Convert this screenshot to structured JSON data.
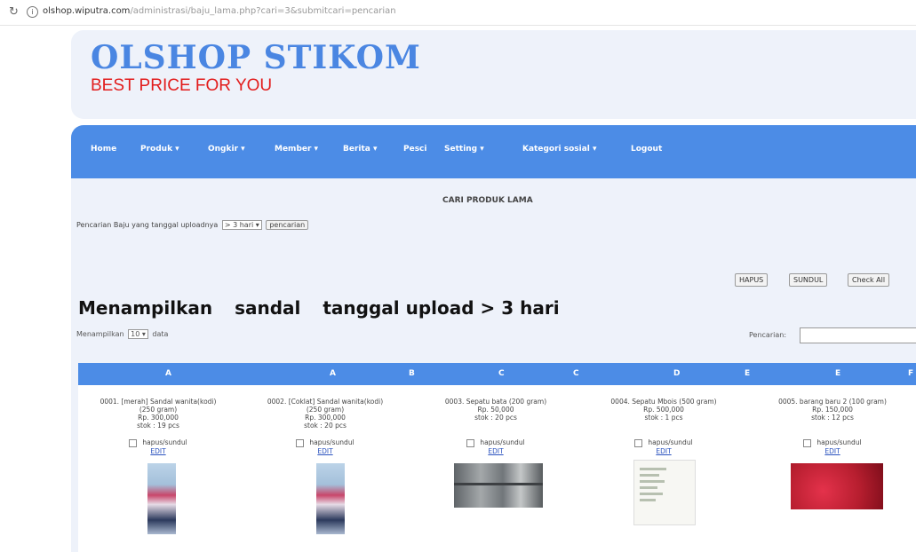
{
  "browser": {
    "domain": "olshop.wiputra.com",
    "path": "/administrasi/baju_lama.php?cari=3&submitcari=pencarian"
  },
  "site": {
    "title": "OLSHOP STIKOM",
    "tagline": "BEST PRICE FOR YOU"
  },
  "nav": [
    {
      "label": "Home"
    },
    {
      "label": "Produk ▾"
    },
    {
      "label": "Ongkir ▾"
    },
    {
      "label": "Member ▾"
    },
    {
      "label": "Berita ▾"
    },
    {
      "label": "Pesci"
    },
    {
      "label": "Setting ▾"
    },
    {
      "label": "Kategori sosial ▾"
    },
    {
      "label": "Logout"
    }
  ],
  "search_panel": {
    "title": "CARI PRODUK LAMA",
    "filter_label": "Pencarian Baju yang tanggal uploadnya",
    "filter_value": "> 3 hari",
    "filter_button": "pencarian"
  },
  "actions": {
    "hapus": "HAPUS",
    "sundul": "SUNDUL",
    "check_all": "Check All"
  },
  "headline": {
    "prefix": "Menampilkan",
    "keyword": "sandal",
    "suffix": "tanggal upload > 3 hari"
  },
  "table_controls": {
    "show_prefix": "Menampilkan",
    "show_value": "10",
    "show_suffix": "data",
    "search_label": "Pencarian:",
    "search_value": ""
  },
  "table_header": [
    "A",
    "A",
    "B",
    "C",
    "C",
    "D",
    "E",
    "E",
    "F"
  ],
  "products": [
    {
      "name": "0001. [merah] Sandal wanita(kodi)",
      "weight": "(250 gram)",
      "price": "Rp. 300,000",
      "stock": "stok : 19 pcs",
      "check": "hapus/sundul",
      "edit": "EDIT"
    },
    {
      "name": "0002. [Coklat] Sandal wanita(kodi)",
      "weight": "(250 gram)",
      "price": "Rp. 300,000",
      "stock": "stok : 20 pcs",
      "check": "hapus/sundul",
      "edit": "EDIT"
    },
    {
      "name": "0003. Sepatu bata (200 gram)",
      "weight": "",
      "price": "Rp. 50,000",
      "stock": "stok : 20 pcs",
      "check": "hapus/sundul",
      "edit": "EDIT"
    },
    {
      "name": "0004. Sepatu Mbois (500 gram)",
      "weight": "",
      "price": "Rp. 500,000",
      "stock": "stok : 1 pcs",
      "check": "hapus/sundul",
      "edit": "EDIT"
    },
    {
      "name": "0005. barang baru 2 (100 gram)",
      "weight": "",
      "price": "Rp. 150,000",
      "stock": "stok : 12 pcs",
      "check": "hapus/sundul",
      "edit": "EDIT"
    }
  ]
}
